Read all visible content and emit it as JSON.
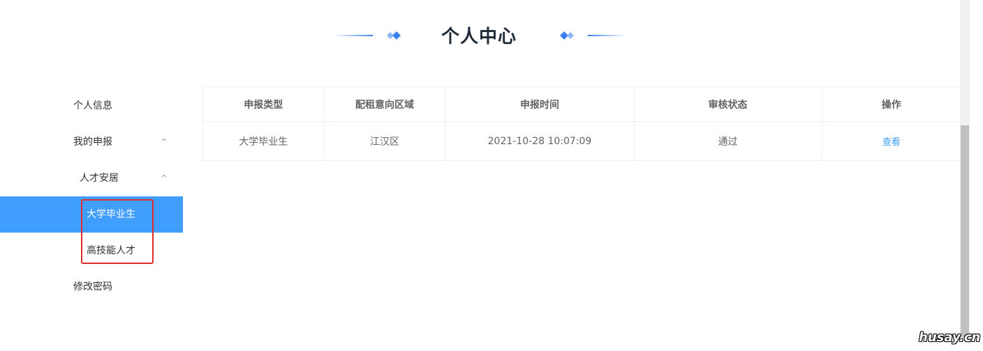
{
  "header": {
    "title": "个人中心"
  },
  "sidebar": {
    "items": [
      {
        "label": "个人信息"
      },
      {
        "label": "我的申报",
        "chevron": "^"
      },
      {
        "label": "人才安居",
        "chevron": "^"
      },
      {
        "label": "大学毕业生",
        "active": true
      },
      {
        "label": "高技能人才"
      },
      {
        "label": "修改密码"
      }
    ]
  },
  "table": {
    "columns": [
      "申报类型",
      "配租意向区域",
      "申报时间",
      "审核状态",
      "操作"
    ],
    "rows": [
      [
        "大学毕业生",
        "江汉区",
        "2021-10-28 10:07:09",
        "通过",
        "查看"
      ]
    ]
  },
  "watermark": "husay.cn",
  "colors": {
    "accent": "#409eff",
    "annotation": "#e02c2c",
    "title": "#1f2a3a"
  },
  "icons": {
    "header_decoration": "diamond-icon",
    "submenu_toggle": "chevron-up-icon"
  }
}
